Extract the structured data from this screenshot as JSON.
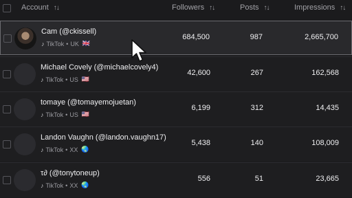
{
  "header": {
    "account": "Account",
    "followers": "Followers",
    "posts": "Posts",
    "impressions": "Impressions",
    "sort_glyph": "↑↓"
  },
  "rows": [
    {
      "name": "Cam (@ckissell)",
      "platform": "TikTok",
      "region": "UK",
      "flag": "🇬🇧",
      "followers": "684,500",
      "posts": "987",
      "impressions": "2,665,700"
    },
    {
      "name": "Michael Covely (@michaelcovely4)",
      "platform": "TikTok",
      "region": "US",
      "flag": "🇺🇸",
      "followers": "42,600",
      "posts": "267",
      "impressions": "162,568"
    },
    {
      "name": "tomaye (@tomayemojuetan)",
      "platform": "TikTok",
      "region": "US",
      "flag": "🇺🇸",
      "followers": "6,199",
      "posts": "312",
      "impressions": "14,435"
    },
    {
      "name": "Landon Vaughn (@landon.vaughn17)",
      "platform": "TikTok",
      "region": "XX",
      "flag": "🌏",
      "followers": "5,438",
      "posts": "140",
      "impressions": "108,009"
    },
    {
      "name": "τ∂ (@tonytoneup)",
      "platform": "TikTok",
      "region": "XX",
      "flag": "🌏",
      "followers": "556",
      "posts": "51",
      "impressions": "23,665"
    }
  ],
  "separator": "•",
  "icons": {
    "platform": "tiktok-icon",
    "sort": "sort-icon",
    "cursor": "pointer-cursor"
  },
  "colors": {
    "background": "#1b1b1d",
    "highlight_row": "#29292c",
    "muted_text": "#9b9ba1"
  }
}
